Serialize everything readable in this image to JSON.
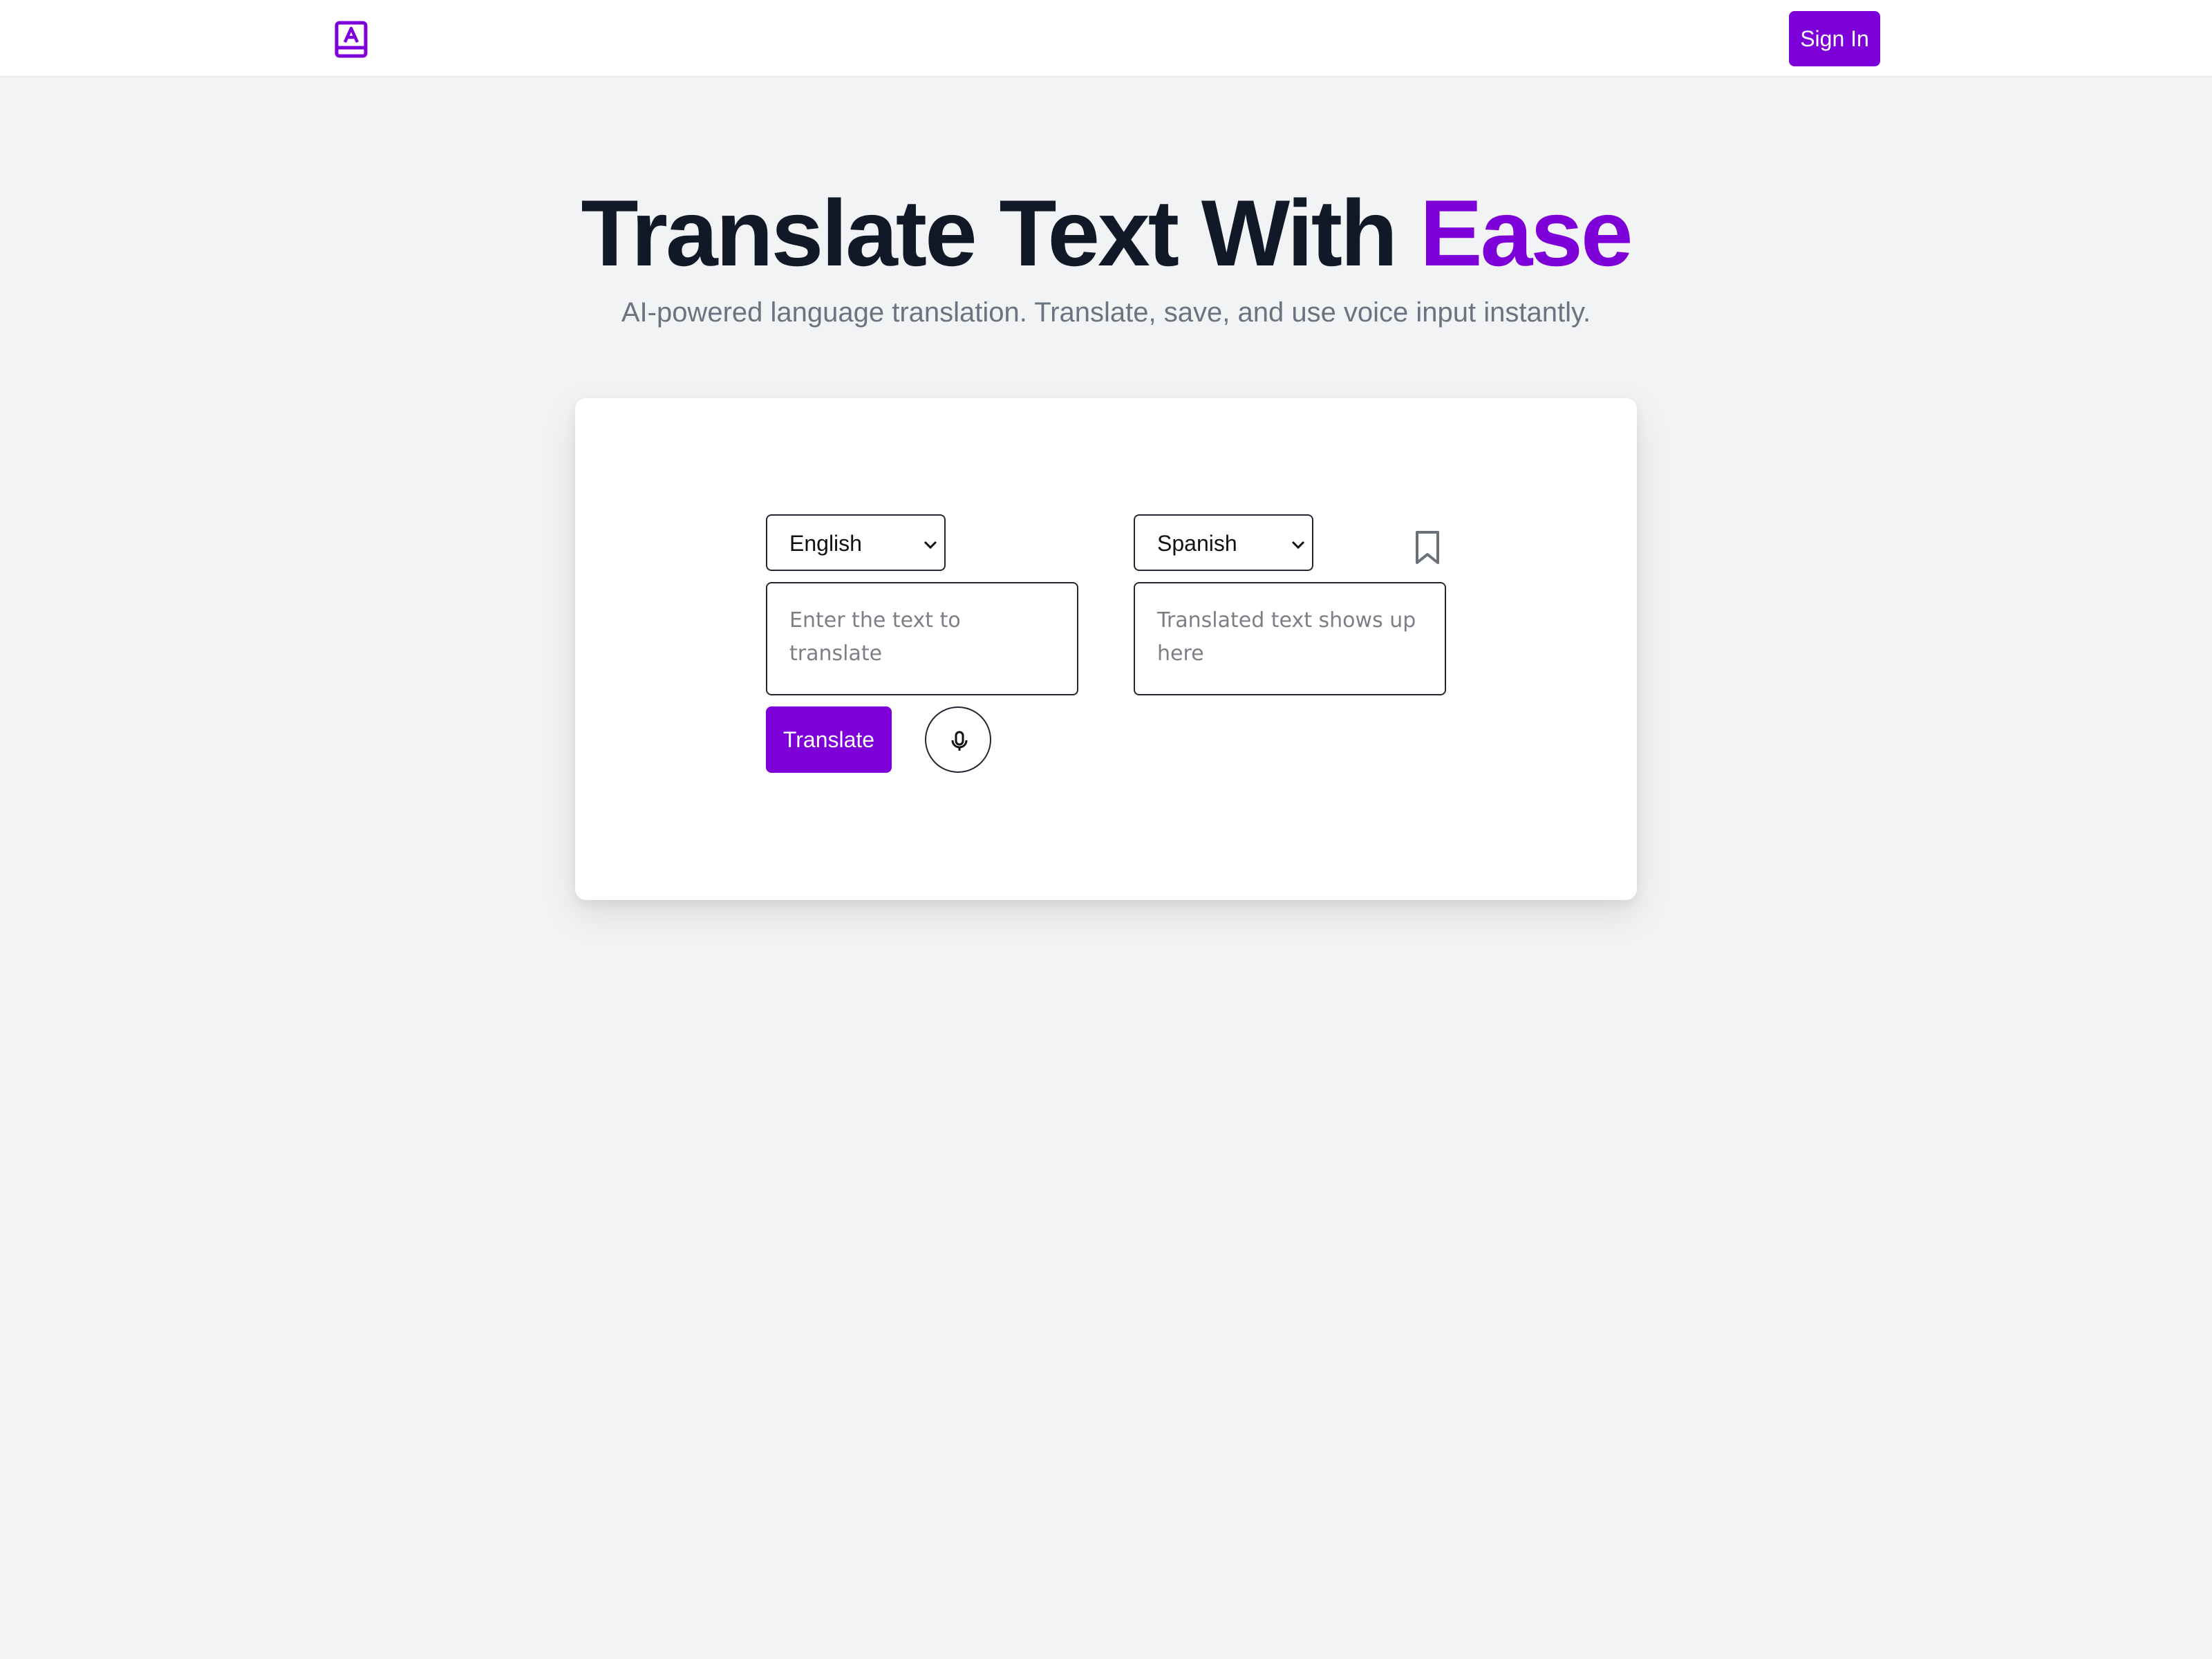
{
  "header": {
    "logo_icon": "book-translate-icon",
    "sign_in_label": "Sign In"
  },
  "hero": {
    "title_main": "Translate Text With ",
    "title_accent": "Ease",
    "subtitle": "AI-powered language translation. Translate, save, and use voice input instantly."
  },
  "translator": {
    "source_language": "English",
    "target_language": "Spanish",
    "source_placeholder": "Enter the text to translate",
    "target_placeholder": "Translated text shows up here",
    "translate_label": "Translate",
    "mic_icon": "microphone-icon",
    "bookmark_icon": "bookmark-icon"
  },
  "colors": {
    "accent": "#7e00d9",
    "page_bg": "#f2f3f5",
    "heading": "#111827",
    "muted": "#6b7280"
  }
}
